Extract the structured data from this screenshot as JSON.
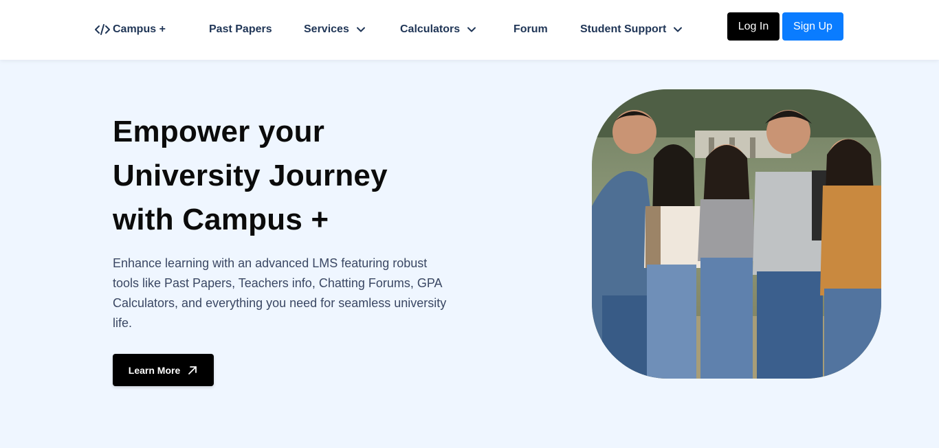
{
  "nav": {
    "brand": "Campus +",
    "items": [
      {
        "label": "Past Papers",
        "has_dropdown": false
      },
      {
        "label": "Services",
        "has_dropdown": true
      },
      {
        "label": "Calculators",
        "has_dropdown": true
      },
      {
        "label": "Forum",
        "has_dropdown": false
      },
      {
        "label": "Student Support",
        "has_dropdown": true
      }
    ],
    "login_label": "Log In",
    "signup_label": "Sign Up"
  },
  "hero": {
    "title_lines": [
      "Empower your",
      "University Journey",
      "with Campus +"
    ],
    "description": "Enhance learning with an advanced LMS featuring robust tools like Past Papers, Teachers info, Chatting Forums, GPA Calculators, and everything you need for seamless university life.",
    "cta_label": "Learn More"
  },
  "colors": {
    "page_background": "#eff6ff",
    "nav_text": "#1f3556",
    "login_button": "#000000",
    "signup_button": "#0a7cff",
    "cta_button": "#000000"
  },
  "icons": {
    "brand": "code-icon",
    "dropdown": "chevron-down-icon",
    "cta": "arrow-up-right-icon"
  }
}
